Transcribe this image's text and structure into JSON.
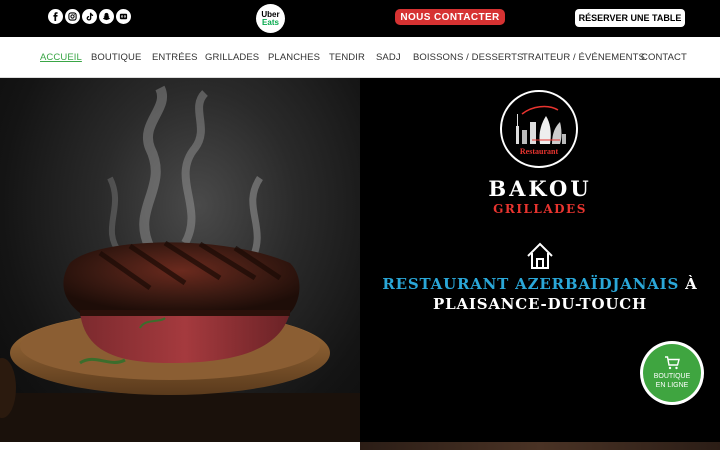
{
  "topbar": {
    "social_icons": [
      "facebook-icon",
      "instagram-icon",
      "tiktok-icon",
      "snapchat-icon",
      "tripadvisor-icon"
    ],
    "ubereats": {
      "line1": "Uber",
      "line2": "Eats"
    },
    "contact_button": "NOUS CONTACTER",
    "reserve_button": "RÉSERVER UNE TABLE"
  },
  "nav": {
    "items": [
      {
        "label": "ACCUEIL",
        "active": true
      },
      {
        "label": "BOUTIQUE"
      },
      {
        "label": "ENTRÉES"
      },
      {
        "label": "GRILLADES"
      },
      {
        "label": "PLANCHES"
      },
      {
        "label": "TENDIR"
      },
      {
        "label": "SADJ"
      },
      {
        "label": "BOISSONS / DESSERTS"
      },
      {
        "label": "TRAITEUR / ÉVÉNEMENTS"
      },
      {
        "label": "CONTACT"
      }
    ]
  },
  "hero": {
    "logo_word": "Restaurant",
    "brand_name": "BAKOU",
    "brand_sub": "GRILLADES",
    "tagline_blue": "RESTAURANT AZERBAÏDJANAIS",
    "tagline_white": " À",
    "tagline_line2": "PLAISANCE-DU-TOUCH",
    "shop_badge": {
      "line1": "BOUTIQUE",
      "line2": "EN LIGNE"
    }
  },
  "colors": {
    "accent_green": "#3aa646",
    "contact_red": "#d63232",
    "brand_red": "#e8342f",
    "tagline_blue": "#2aa7d8"
  }
}
